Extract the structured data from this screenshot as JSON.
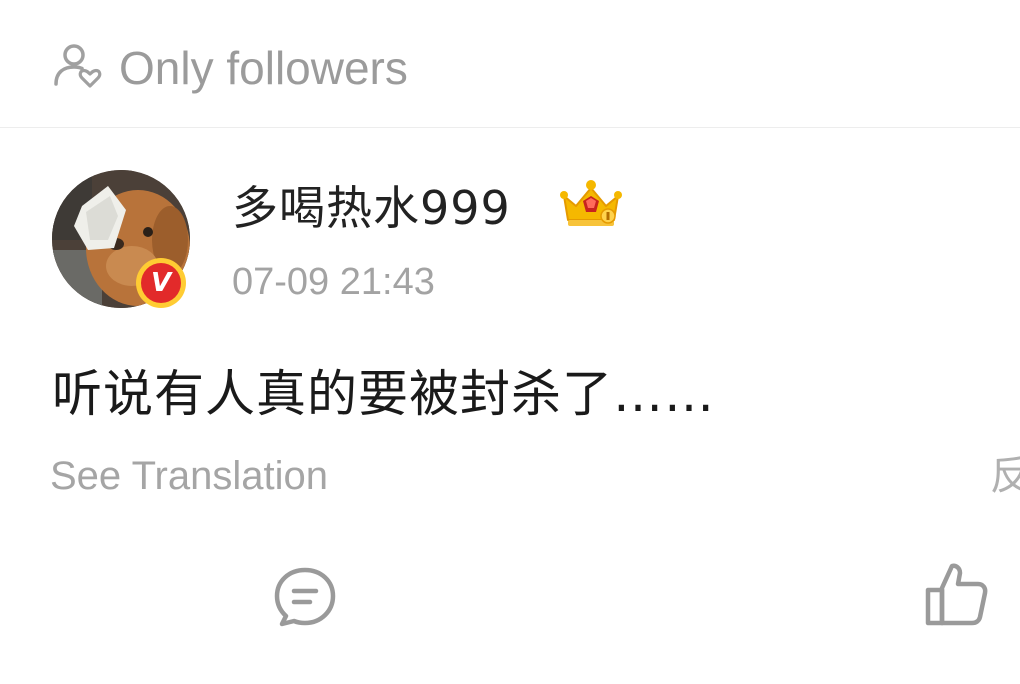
{
  "visibility": {
    "icon": "user-heart-icon",
    "label": "Only followers"
  },
  "post": {
    "author": {
      "name": "多喝热水999",
      "avatar": "dog-photo-avatar",
      "verified_badge": "V",
      "verified_color": "#e22a2a",
      "rank_badge": "crown-badge-icon"
    },
    "timestamp": "07-09 21:43",
    "text": "听说有人真的要被封杀了……",
    "translate_label": "See Translation",
    "clipped_right_glyph": "反"
  },
  "actions": {
    "comment_icon": "comment-icon",
    "like_icon": "thumbs-up-icon"
  },
  "colors": {
    "primary_text": "#1a1a1a",
    "secondary_text": "#a3a3a3",
    "crown_gold": "#f5b800"
  }
}
